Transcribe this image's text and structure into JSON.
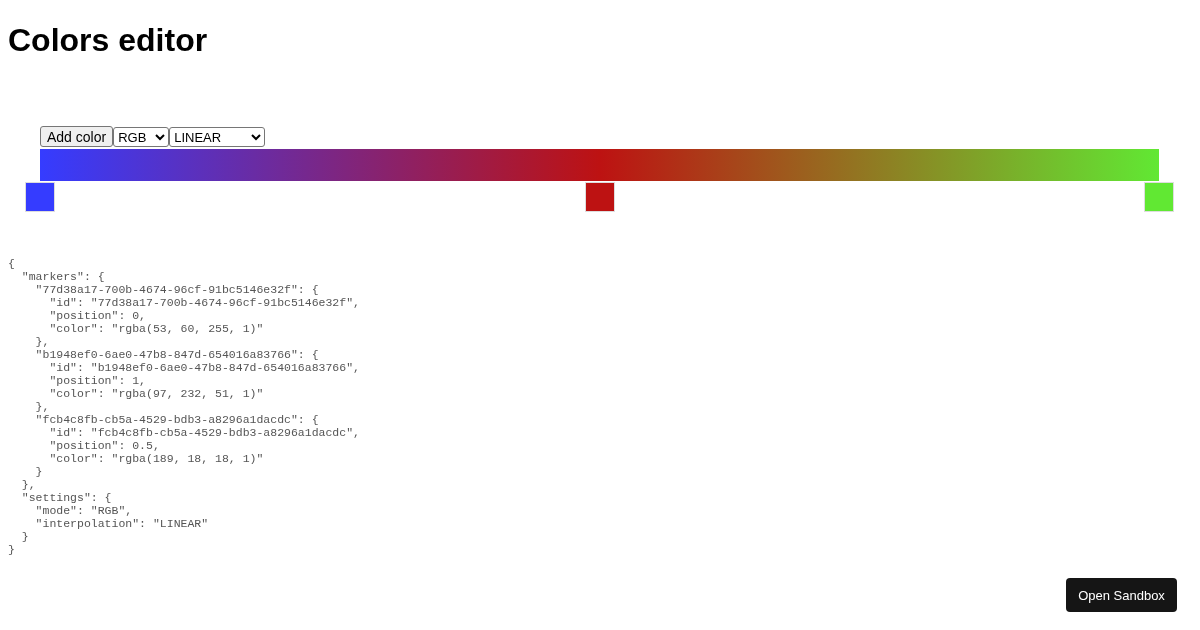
{
  "title": "Colors editor",
  "toolbar": {
    "add_button": "Add color",
    "mode": "RGB",
    "interpolation": "LINEAR"
  },
  "markers": [
    {
      "color": "#353cff",
      "level": 0
    },
    {
      "color": "#bd1212",
      "level": 0.5
    },
    {
      "color": "#61e833",
      "level": 1
    }
  ],
  "code_lines": [
    "{",
    "  \"markers\": {",
    "    \"77d38a17-700b-4674-96cf-91bc5146e32f\": {",
    "      \"id\": \"77d38a17-700b-4674-96cf-91bc5146e32f\",",
    "      \"position\": 0,",
    "      \"color\": \"rgba(53, 60, 255, 1)\"",
    "    },",
    "    \"b1948ef0-6ae0-47b8-847d-654016a83766\": {",
    "      \"id\": \"b1948ef0-6ae0-47b8-847d-654016a83766\",",
    "      \"position\": 1,",
    "      \"color\": \"rgba(97, 232, 51, 1)\"",
    "    },",
    "    \"fcb4c8fb-cb5a-4529-bdb3-a8296a1dacdc\": {",
    "      \"id\": \"fcb4c8fb-cb5a-4529-bdb3-a8296a1dacdc\",",
    "      \"position\": 0.5,",
    "      \"color\": \"rgba(189, 18, 18, 1)\"",
    "    }",
    "  },",
    "  \"settings\": {",
    "    \"mode\": \"RGB\",",
    "    \"interpolation\": \"LINEAR\"",
    "  }",
    "}"
  ],
  "sandbox_button": "Open Sandbox"
}
